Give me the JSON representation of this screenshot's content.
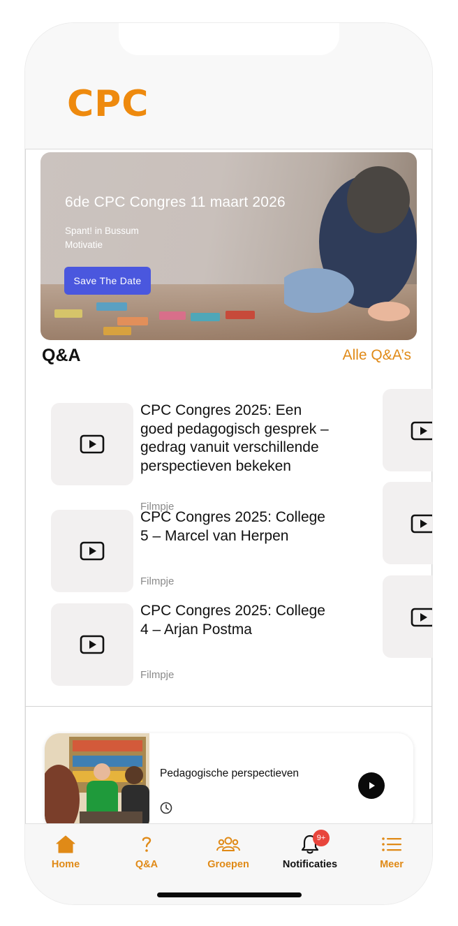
{
  "header": {
    "logo_text": "CPC"
  },
  "banner": {
    "title": "6de CPC Congres 11 maart 2026",
    "subtitle_1": "Spant! in Bussum",
    "subtitle_2": "Motivatie",
    "button_label": "Save The Date"
  },
  "qa": {
    "title": "Q&A",
    "all_link": "Alle Q&A’s",
    "items": [
      {
        "title": "CPC Congres 2025: Een goed pedagogisch gesprek – gedrag vanuit verschillende perspectieven bekeken",
        "type": "Filmpje",
        "icon": "play-icon"
      },
      {
        "title": "CPC Congres 2025: College 5 – Marcel van Herpen",
        "type": "Filmpje",
        "icon": "play-icon"
      },
      {
        "title": "CPC Congres 2025: College 4 – Arjan Postma",
        "type": "Filmpje",
        "icon": "play-icon"
      }
    ]
  },
  "feature": {
    "title": "Pedagogische perspectieven",
    "icons": [
      "clock-icon",
      "play-circle-icon"
    ]
  },
  "tabbar": {
    "tabs": [
      {
        "label": "Home",
        "icon": "home-icon"
      },
      {
        "label": "Q&A",
        "icon": "question-icon"
      },
      {
        "label": "Groepen",
        "icon": "group-icon"
      },
      {
        "label": "Notificaties",
        "icon": "bell-icon",
        "active": true
      },
      {
        "label": "Meer",
        "icon": "menu-icon"
      }
    ],
    "badge": "9+"
  },
  "colors": {
    "accent": "#e08a17",
    "logo": "#ee8a0e",
    "button": "#4a57de",
    "badge": "#e8453c"
  }
}
